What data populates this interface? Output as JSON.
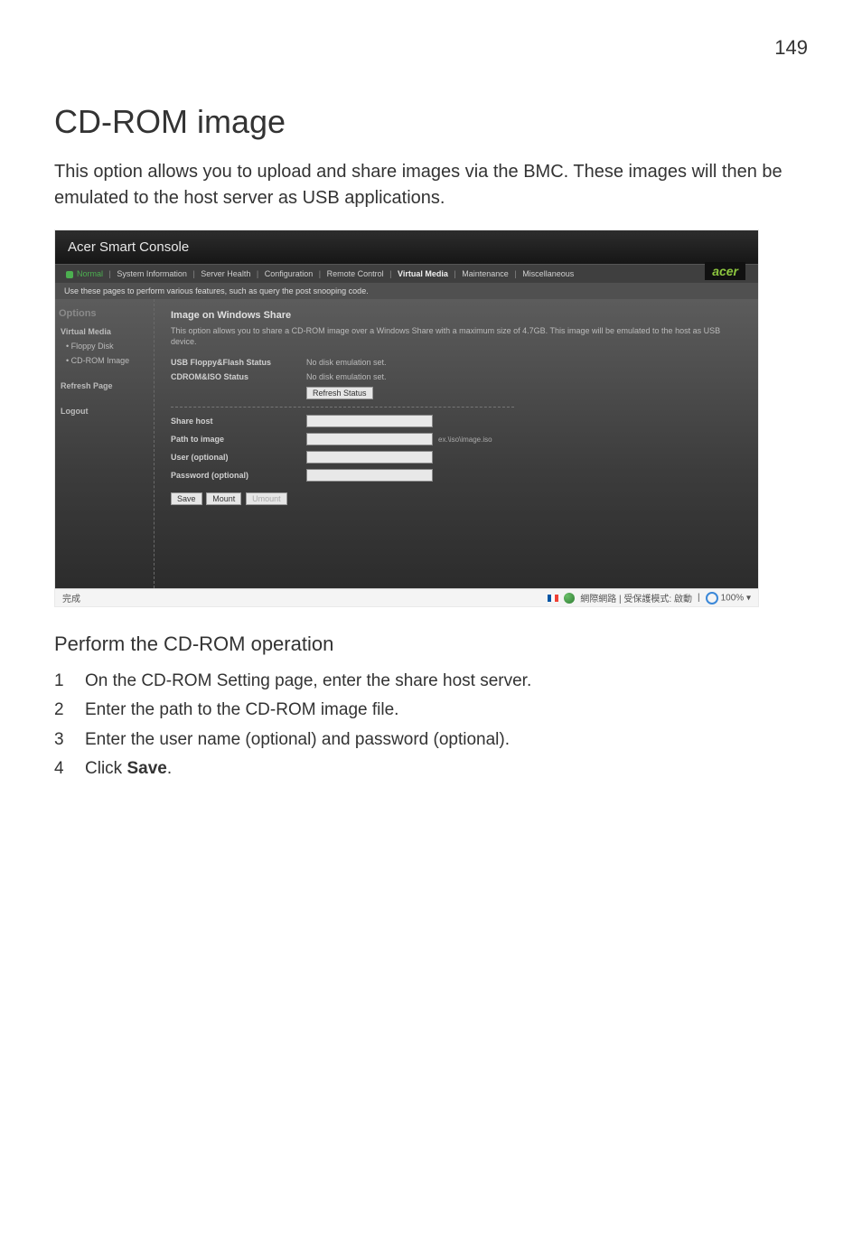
{
  "page_number": "149",
  "heading": "CD-ROM image",
  "intro": "This option allows you to upload and share images via the BMC. These images will then be emulated to the host server as USB applications.",
  "subheading": "Perform the CD-ROM operation",
  "steps": [
    {
      "num": "1",
      "text": "On the CD-ROM Setting page, enter the share host server."
    },
    {
      "num": "2",
      "text": "Enter the path to the CD-ROM image file."
    },
    {
      "num": "3",
      "text": "Enter the user name (optional) and password (optional)."
    },
    {
      "num": "4",
      "text_prefix": "Click ",
      "text_bold": "Save",
      "text_suffix": "."
    }
  ],
  "screenshot": {
    "title": "Acer Smart Console",
    "brand": "acer",
    "nav": {
      "status": "Normal",
      "items": [
        "System Information",
        "Server Health",
        "Configuration",
        "Remote Control",
        "Virtual Media",
        "Maintenance",
        "Miscellaneous"
      ],
      "active_index": 4
    },
    "subbar": "Use these pages to perform various features, such as query the post snooping code.",
    "sidebar": {
      "heading": "Options",
      "group": "Virtual Media",
      "items": [
        "Floppy Disk",
        "CD-ROM Image"
      ],
      "free": [
        "Refresh Page",
        "Logout"
      ]
    },
    "main": {
      "title": "Image on Windows Share",
      "desc": "This option allows you to share a CD-ROM image over a Windows Share with a maximum size of 4.7GB. This image will be emulated to the host as USB device.",
      "status_rows": [
        {
          "label": "USB Floppy&Flash Status",
          "value": "No disk emulation set."
        },
        {
          "label": "CDROM&ISO Status",
          "value": "No disk emulation set."
        }
      ],
      "refresh_btn": "Refresh Status",
      "form_rows": [
        {
          "label": "Share host",
          "hint": ""
        },
        {
          "label": "Path to image",
          "hint": "ex.\\iso\\image.iso"
        },
        {
          "label": "User (optional)",
          "hint": ""
        },
        {
          "label": "Password (optional)",
          "hint": ""
        }
      ],
      "buttons": {
        "save": "Save",
        "mount": "Mount",
        "umount": "Umount"
      }
    },
    "statusbar": {
      "left": "完成",
      "mode": "網際網路 | 受保護模式: 啟動",
      "zoom": "100%"
    }
  }
}
